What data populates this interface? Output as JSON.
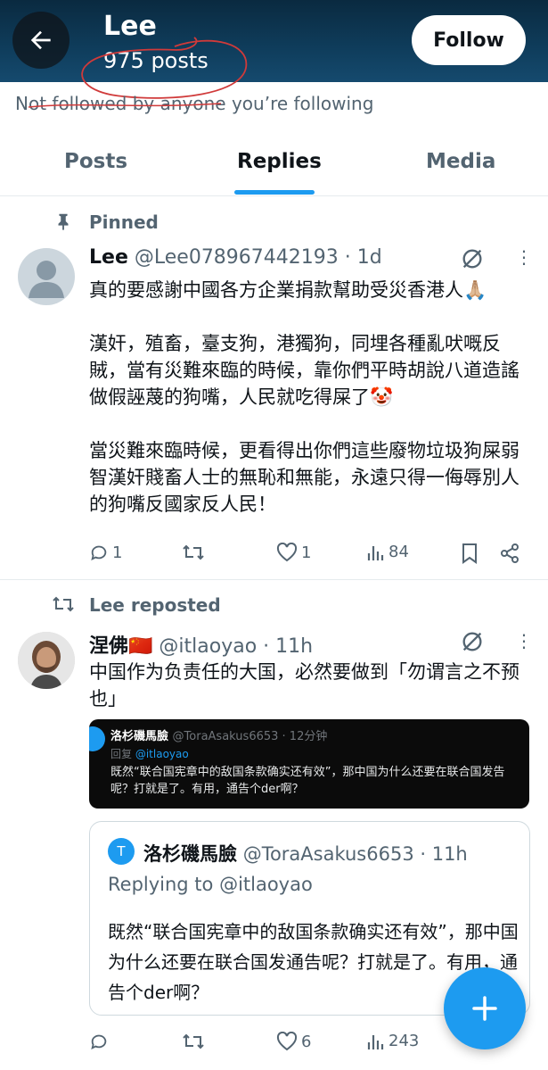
{
  "header": {
    "name": "Lee",
    "posts": "975 posts",
    "follow_label": "Follow"
  },
  "profile": {
    "not_followed": "Not followed by anyone you’re following"
  },
  "tabs": [
    {
      "label": "Posts",
      "active": false
    },
    {
      "label": "Replies",
      "active": true
    },
    {
      "label": "Media",
      "active": false
    }
  ],
  "posts": [
    {
      "context": "Pinned",
      "name": "Lee",
      "handle": "@Lee078967442193 · 1d",
      "text": "真的要感謝中國各方企業捐款幫助受災香港人🙏🏼\n\n漢奸，殖畜，臺支狗，港獨狗，同埋各種亂吠嘅反賊，當有災難來臨的時候，靠你們平時胡說八道造謠做假誣蔑的狗嘴，人民就吃得屎了🤡\n\n當災難來臨時候，更看得出你們這些廢物垃圾狗屎弱智漢奸賤畜人士的無恥和無能，永遠只得一侮辱別人的狗嘴反國家反人民！",
      "replies": "1",
      "reposts": "",
      "likes": "1",
      "views": "84"
    },
    {
      "context": "Lee reposted",
      "name": "涅佛🇨🇳",
      "handle": "@itlaoyao · 11h",
      "text": "中国作为负责任的大国，必然要做到「勿谓言之不预也」",
      "replies": "",
      "reposts": "",
      "likes": "6",
      "views": "243",
      "embedded_image": {
        "name": "洛杉磯馬臉",
        "handle": "@ToraAsakus6653 · 12分钟",
        "reply_prefix": "回复",
        "reply_to": "@itlaoyao",
        "text": "既然“联合国宪章中的敌国条款确实还有效”，那中国为什么还要在联合国发告呢？打就是了。有用，通告个der啊？"
      },
      "quote": {
        "avatar_letter": "T",
        "name": "洛杉磯馬臉",
        "handle": "@ToraAsakus6653 · 11h",
        "replying_to": "Replying to @itlaoyao",
        "text": "既然“联合国宪章中的敌国条款确实还有效”，那中国为什么还要在联合国发通告呢？打就是了。有用，通告个der啊？"
      }
    }
  ],
  "colors": {
    "accent": "#1d9bf0",
    "header_bg": "#0f3d5c",
    "muted": "#536471",
    "scribble": "#d03a3a"
  },
  "icons": [
    "back-arrow-icon",
    "pin-icon",
    "repost-icon",
    "grok-icon",
    "more-icon",
    "reply-icon",
    "like-icon",
    "views-icon",
    "bookmark-icon",
    "share-icon",
    "compose-plus-icon"
  ]
}
